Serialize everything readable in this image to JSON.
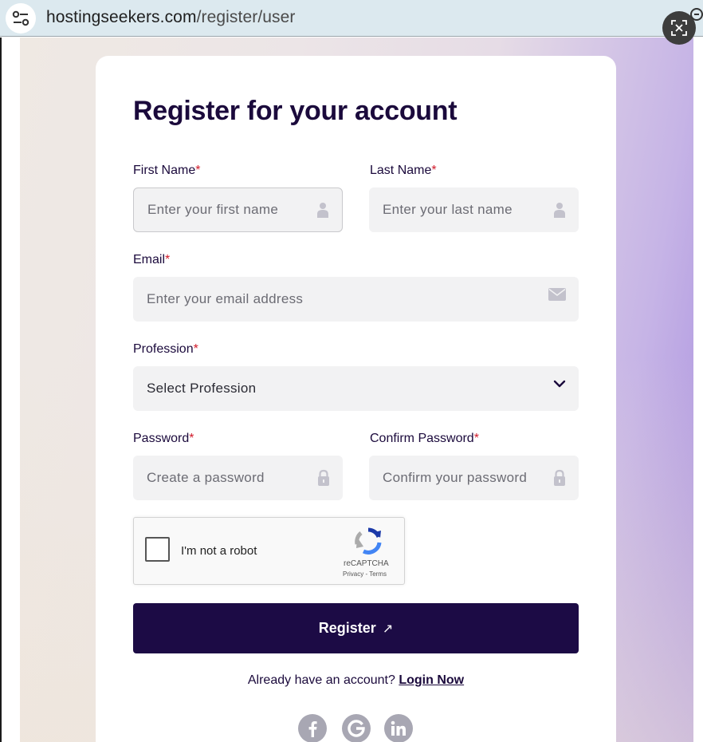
{
  "browser": {
    "url_domain": "hostingseekers.com",
    "url_path": "/register/user",
    "site_info_icon": "tune-icon",
    "lens_icon": "google-lens-icon"
  },
  "form": {
    "title": "Register for your account",
    "required_mark": "*",
    "first_name": {
      "label": "First Name",
      "placeholder": "Enter your first name",
      "icon": "user-icon"
    },
    "last_name": {
      "label": "Last Name",
      "placeholder": "Enter your last name",
      "icon": "user-icon"
    },
    "email": {
      "label": "Email",
      "placeholder": "Enter your email address",
      "icon": "envelope-icon"
    },
    "profession": {
      "label": "Profession",
      "selected": "Select Profession",
      "icon": "chevron-down-icon"
    },
    "password": {
      "label": "Password",
      "placeholder": "Create a password",
      "icon": "lock-icon"
    },
    "confirm_password": {
      "label": "Confirm Password",
      "placeholder": "Confirm your password",
      "icon": "lock-icon"
    }
  },
  "captcha": {
    "label": "I'm not a robot",
    "brand": "reCAPTCHA",
    "links": "Privacy - Terms"
  },
  "register_button": {
    "label": "Register",
    "arrow": "↗"
  },
  "login": {
    "prompt": "Already have an account?",
    "link": "Login Now"
  },
  "social": [
    "facebook-icon",
    "google-icon",
    "linkedin-icon"
  ],
  "colors": {
    "primary": "#1c0b45",
    "required": "#d11a2a",
    "field_bg": "#f2f2f3",
    "icon_gray": "#a8a7b3"
  }
}
